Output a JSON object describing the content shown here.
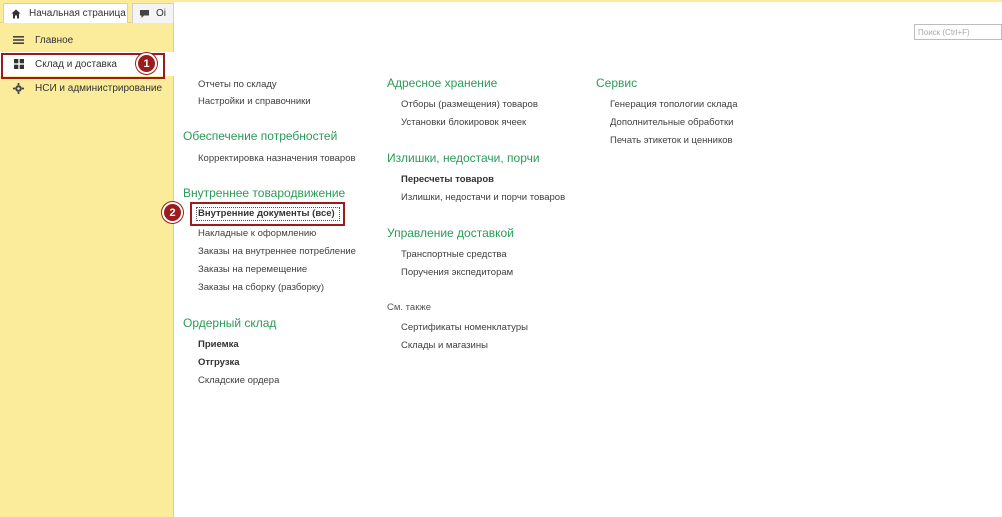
{
  "tabs": {
    "home_label": "Начальная страница",
    "second_label": "Оі"
  },
  "sidebar": {
    "items": [
      {
        "label": "Главное",
        "icon": "menu-lines-icon"
      },
      {
        "label": "Склад и доставка",
        "icon": "grid-icon"
      },
      {
        "label": "НСИ и администрирование",
        "icon": "gear-icon"
      }
    ]
  },
  "search": {
    "placeholder": "Поиск (Ctrl+F)"
  },
  "callouts": {
    "one": "1",
    "two": "2"
  },
  "content": {
    "col1": {
      "links_top": [
        "Отчеты по складу",
        "Настройки и справочники"
      ],
      "sections": [
        {
          "title": "Обеспечение потребностей",
          "links": [
            "Корректировка назначения товаров"
          ]
        },
        {
          "title": "Внутреннее товародвижение",
          "links": [
            "Внутренние документы (все)",
            "Накладные к оформлению",
            "Заказы на внутреннее потребление",
            "Заказы на перемещение",
            "Заказы на сборку (разборку)"
          ]
        },
        {
          "title": "Ордерный склад",
          "links": [
            "Приемка",
            "Отгрузка",
            "Складские ордера"
          ]
        }
      ]
    },
    "col2": {
      "sections": [
        {
          "title": "Адресное хранение",
          "links": [
            "Отборы (размещения) товаров",
            "Установки блокировок ячеек"
          ]
        },
        {
          "title": "Излишки, недостачи, порчи",
          "links": [
            "Пересчеты товаров",
            "Излишки, недостачи и порчи товаров"
          ]
        },
        {
          "title": "Управление доставкой",
          "links": [
            "Транспортные средства",
            "Поручения экспедиторам"
          ]
        }
      ],
      "see_also_label": "См. также",
      "see_also_links": [
        "Сертификаты номенклатуры",
        "Склады и магазины"
      ]
    },
    "col3": {
      "sections": [
        {
          "title": "Сервис",
          "links": [
            "Генерация топологии склада",
            "Дополнительные обработки",
            "Печать этикеток и ценников"
          ]
        }
      ]
    }
  },
  "colors": {
    "panel": "#fbec9b",
    "section_title": "#2a9b57",
    "callout": "#9b1c1c"
  }
}
